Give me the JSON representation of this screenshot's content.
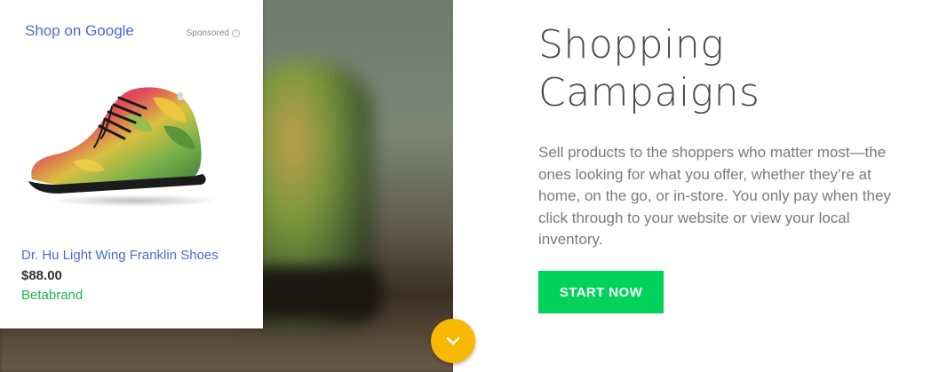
{
  "ad_card": {
    "shop_link": "Shop on Google",
    "sponsored_label": "Sponsored",
    "info_icon": "info-circle",
    "product": {
      "image_icon": "sneaker-image",
      "title": "Dr. Hu Light Wing Franklin Shoes",
      "price": "$88.00",
      "merchant": "Betabrand"
    }
  },
  "hero": {
    "headline": "Shopping Campaigns",
    "description": "Sell products to the shoppers who matter most—the ones looking for what you offer, whether they’re at home, on the go, or in-store. You only pay when they click through to your website or view your local inventory.",
    "cta_label": "START NOW"
  },
  "scroll_button": {
    "icon": "chevron-down"
  },
  "colors": {
    "link_blue": "#4a6ad6",
    "merchant_green": "#21b351",
    "cta_green": "#00d25b",
    "scroll_yellow": "#f9b800",
    "headline_gray": "#4a4a4a",
    "body_gray": "#7a7a7a"
  }
}
